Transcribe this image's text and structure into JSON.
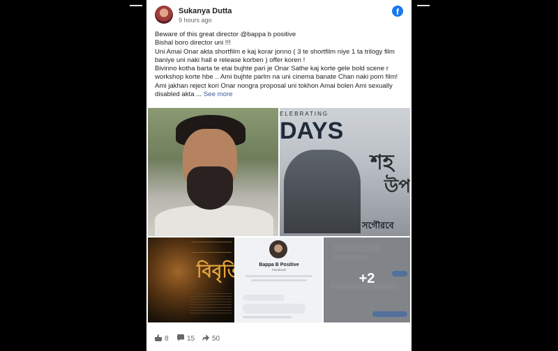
{
  "post": {
    "author": "Sukanya Dutta",
    "time": "9 hours ago",
    "platform_icon": "facebook-icon",
    "brand_color": "#1877f2",
    "text_lines": [
      "Beware of this great director @bappa b positive",
      "Bishal boro director uni !!!",
      "Uni Amai Onar akta shortfilm e kaj korar jonno ( 3 te shortfilm niye 1 ta trilogy film baniye uni naki hall e release korben ) offer koren !",
      "Bivinno kotha barta te etai bujhte pari je Onar Sathe kaj korte gele bold scene r workshop korte hbe .. Ami bujhte parlm na uni cinema banate Chan naki porn film!",
      "Ami jakhan reject kori Onar nongra proposal uni tokhon Amai bolen Ami sexually disabled akta ..."
    ],
    "see_more": "See more"
  },
  "media": {
    "img2_celebrating": "ELEBRATING",
    "img2_days": "DAYS",
    "img2_title": "শহ",
    "img2_subtitle": "উপ",
    "img2_footer": "সগৌরবে",
    "img3_title": "বিবৃতি",
    "chat_name": "Bappa B Positive",
    "chat_sub": "Facebook",
    "more_count": "+2"
  },
  "actions": {
    "likes": "8",
    "comments": "15",
    "shares": "50"
  }
}
